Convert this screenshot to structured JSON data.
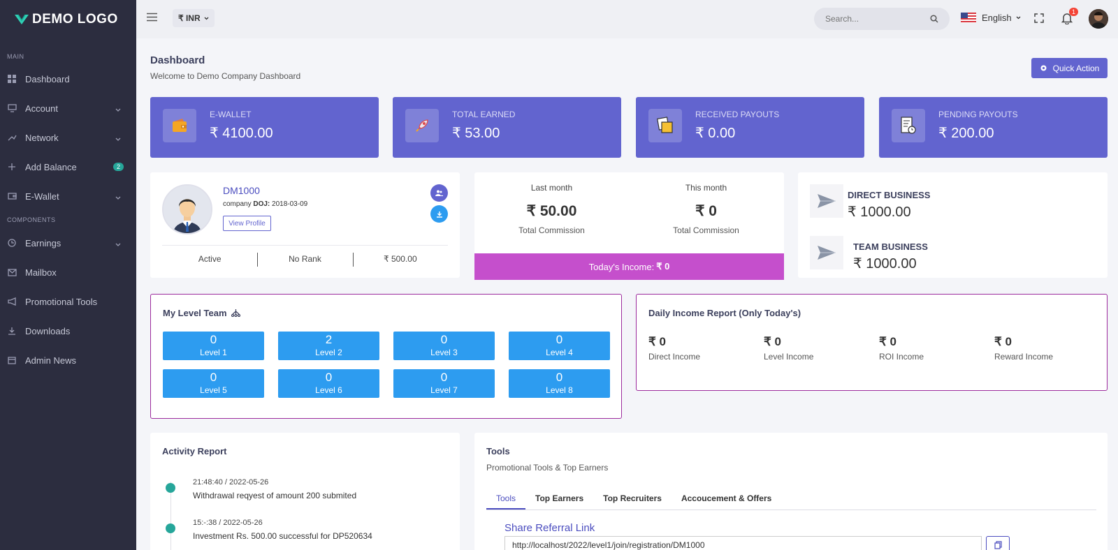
{
  "brand": {
    "logo_text": "DEMO LOGO"
  },
  "sidebar": {
    "main_label": "MAIN",
    "components_label": "COMPONENTS",
    "items": [
      {
        "label": "Dashboard"
      },
      {
        "label": "Account"
      },
      {
        "label": "Network"
      },
      {
        "label": "Add Balance",
        "badge": "2"
      },
      {
        "label": "E-Wallet"
      },
      {
        "label": "Earnings"
      },
      {
        "label": "Mailbox"
      },
      {
        "label": "Promotional Tools"
      },
      {
        "label": "Downloads"
      },
      {
        "label": "Admin News"
      }
    ]
  },
  "topbar": {
    "currency": "₹ INR",
    "search_placeholder": "Search...",
    "language": "English",
    "notification_count": "1"
  },
  "header": {
    "title": "Dashboard",
    "subtitle": "Welcome to Demo Company Dashboard",
    "quick_action": "Quick Action"
  },
  "stats": [
    {
      "label": "E-WALLET",
      "value": "₹ 4100.00"
    },
    {
      "label": "TOTAL EARNED",
      "value": "₹ 53.00"
    },
    {
      "label": "RECEIVED PAYOUTS",
      "value": "₹ 0.00"
    },
    {
      "label": "PENDING PAYOUTS",
      "value": "₹ 200.00"
    }
  ],
  "profile": {
    "username": "DM1000",
    "doj_prefix": "company ",
    "doj_label": "DOJ:",
    "doj_value": " 2018-03-09",
    "view_profile": "View Profile",
    "status": "Active",
    "rank": "No Rank",
    "amount": "₹ 500.00"
  },
  "commission": {
    "last_month_label": "Last month",
    "last_month_value": "₹ 50.00",
    "last_month_sub": "Total Commission",
    "this_month_label": "This month",
    "this_month_value": "₹ 0",
    "this_month_sub": "Total Commission",
    "today_label": "Today's Income: ",
    "today_value": "₹ 0"
  },
  "business": {
    "direct_label": "DIRECT BUSINESS",
    "direct_value": "₹ 1000.00",
    "team_label": "TEAM BUSINESS",
    "team_value": "₹ 1000.00"
  },
  "level_team": {
    "title": "My Level Team",
    "levels": [
      {
        "count": "0",
        "label": "Level 1"
      },
      {
        "count": "2",
        "label": "Level 2"
      },
      {
        "count": "0",
        "label": "Level 3"
      },
      {
        "count": "0",
        "label": "Level 4"
      },
      {
        "count": "0",
        "label": "Level 5"
      },
      {
        "count": "0",
        "label": "Level 6"
      },
      {
        "count": "0",
        "label": "Level 7"
      },
      {
        "count": "0",
        "label": "Level 8"
      }
    ]
  },
  "daily_income": {
    "title": "Daily Income Report (Only Today's)",
    "items": [
      {
        "value": "₹ 0",
        "label": "Direct Income"
      },
      {
        "value": "₹ 0",
        "label": "Level Income"
      },
      {
        "value": "₹ 0",
        "label": "ROI Income"
      },
      {
        "value": "₹ 0",
        "label": "Reward Income"
      }
    ]
  },
  "activity": {
    "title": "Activity Report",
    "items": [
      {
        "time": "21:48:40 / 2022-05-26",
        "text": "Withdrawal reqyest of amount 200 submited"
      },
      {
        "time": "15:-:38 / 2022-05-26",
        "text": "Investment Rs. 500.00 successful for DP520634"
      }
    ]
  },
  "tools": {
    "title": "Tools",
    "subtitle": "Promotional Tools & Top Earners",
    "tabs": [
      "Tools",
      "Top Earners",
      "Top Recruiters",
      "Accoucement & Offers"
    ],
    "share_title": "Share Referral Link",
    "share_link": "http://localhost/2022/level1/join/registration/DM1000"
  },
  "colors": {
    "sidebar_bg": "#2c2d3f",
    "accent": "#6264cf",
    "level_blue": "#2d9cf0",
    "today_magenta": "#c54fcc",
    "border_purple": "#9c2b9d",
    "timeline_green": "#26a69a"
  }
}
